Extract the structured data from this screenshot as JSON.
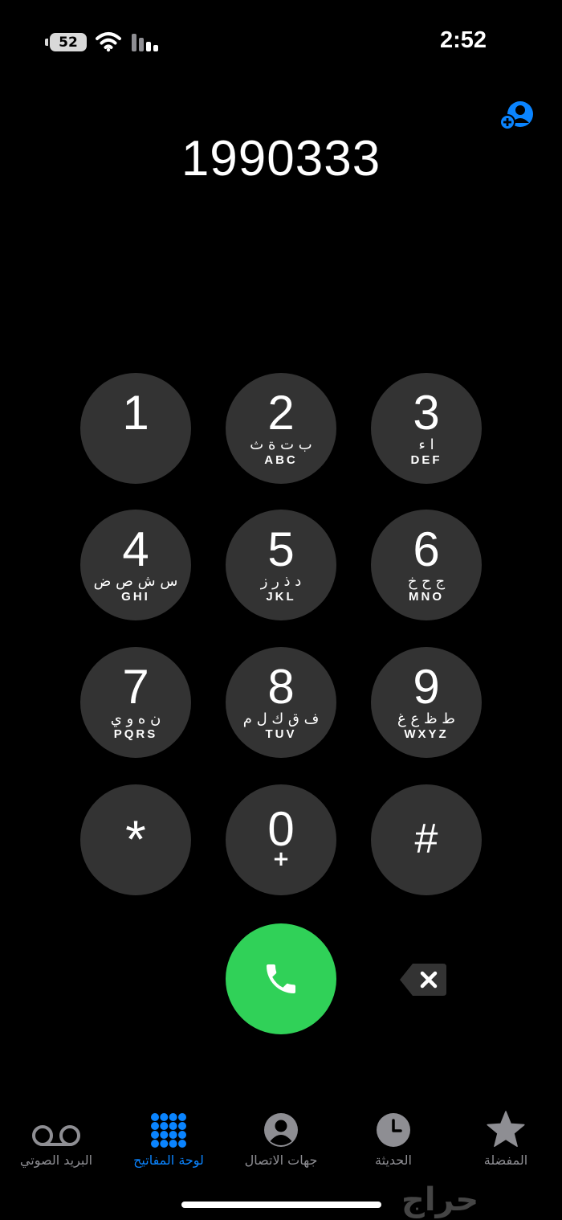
{
  "status": {
    "battery": "52",
    "time": "2:52"
  },
  "dialed_number": "1990333",
  "keypad": [
    {
      "digit": "1",
      "arabic": "",
      "latin": ""
    },
    {
      "digit": "2",
      "arabic": "ب ت ة ث",
      "latin": "ABC"
    },
    {
      "digit": "3",
      "arabic": "ا ء",
      "latin": "DEF"
    },
    {
      "digit": "4",
      "arabic": "س ش ص ض",
      "latin": "GHI"
    },
    {
      "digit": "5",
      "arabic": "د ذ ر ز",
      "latin": "JKL"
    },
    {
      "digit": "6",
      "arabic": "ج ح خ",
      "latin": "MNO"
    },
    {
      "digit": "7",
      "arabic": "ن ه و ي",
      "latin": "PQRS"
    },
    {
      "digit": "8",
      "arabic": "ف ق ك ل م",
      "latin": "TUV"
    },
    {
      "digit": "9",
      "arabic": "ط ظ ع غ",
      "latin": "WXYZ"
    },
    {
      "digit": "*"
    },
    {
      "digit": "0",
      "sub": "+"
    },
    {
      "digit": "#"
    }
  ],
  "tabs": {
    "voicemail": "البريد الصوتي",
    "keypad": "لوحة المفاتيح",
    "contacts": "جهات الاتصال",
    "recents": "الحديثة",
    "favorites": "المفضلة"
  },
  "watermark": "حراج",
  "colors": {
    "accent": "#0a84ff",
    "call": "#30d158",
    "key": "#333333"
  },
  "icons": [
    "wifi-icon",
    "signal-icon",
    "add-contact-icon",
    "phone-icon",
    "backspace-icon",
    "voicemail-icon",
    "keypad-grid-icon",
    "contact-person-icon",
    "clock-icon",
    "star-icon"
  ]
}
